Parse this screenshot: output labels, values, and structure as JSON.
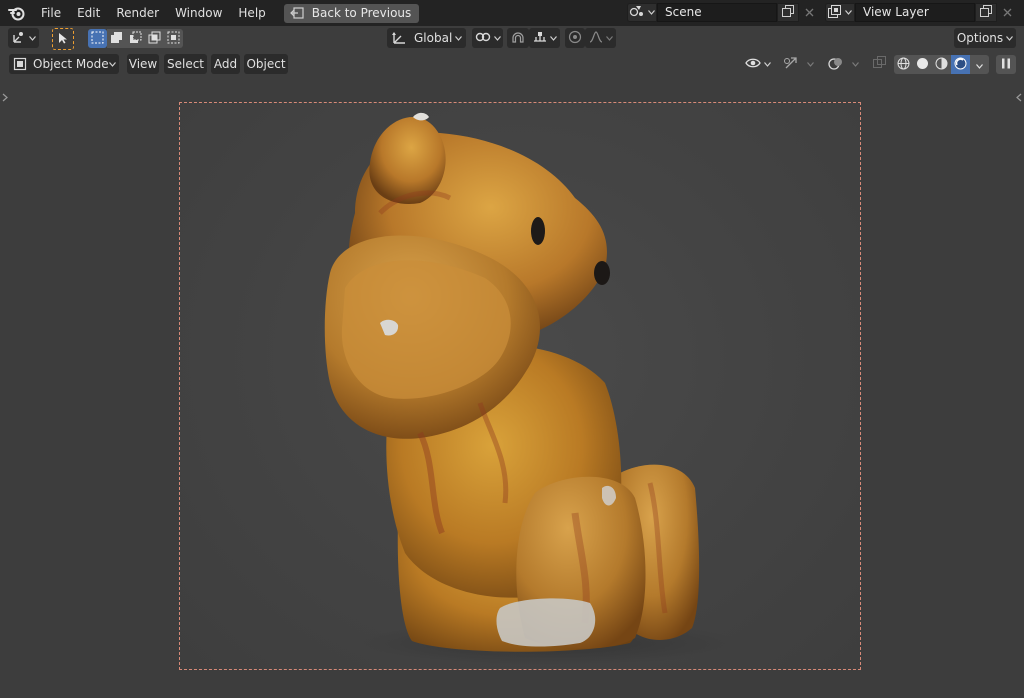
{
  "topbar": {
    "menu": [
      "File",
      "Edit",
      "Render",
      "Window",
      "Help"
    ],
    "back_button": "Back to Previous",
    "scene": {
      "value": "Scene"
    },
    "view_layer": {
      "value": "View Layer"
    }
  },
  "header": {
    "transform_orientation": "Global",
    "options_label": "Options",
    "mode": "Object Mode",
    "menus": [
      "View",
      "Select",
      "Add",
      "Object"
    ]
  },
  "viewport": {
    "object": "teddy-bear-figurine",
    "camera_frame_color": "#d88a78",
    "shading_mode": "rendered"
  },
  "colors": {
    "topbar_bg": "#232323",
    "header_bg": "#3d3d3d",
    "accent": "#4772b3",
    "active_tool": "#f0a030"
  }
}
